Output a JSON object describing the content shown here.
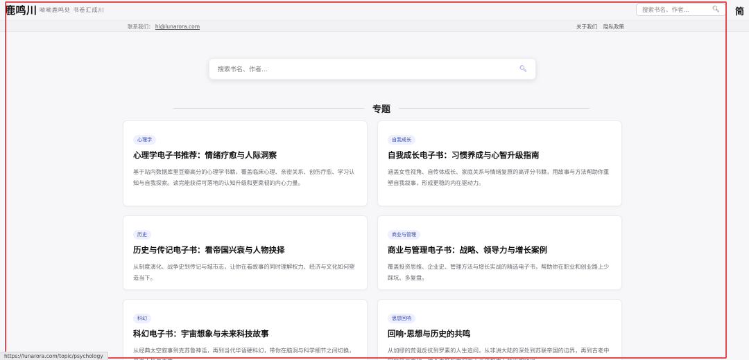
{
  "header": {
    "logo": "鹿鸣川",
    "slogan": "呦呦鹿鸣处 书卷汇成川",
    "search_placeholder": "搜索书名、作者...",
    "right_cut_text": "简"
  },
  "contact_bar": {
    "label": "联系我们：",
    "email": "hi@lunarora.com",
    "links": [
      "关于我们",
      "隐私政策"
    ]
  },
  "hero": {
    "search_placeholder": "搜索书名、作者..."
  },
  "section": {
    "title": "专题"
  },
  "cards": [
    {
      "tag": "心理学",
      "title": "心理学电子书推荐：情绪疗愈与人际洞察",
      "desc": "基于站内数据库里豆瓣高分的心理学书籍，覆盖临床心理、亲密关系、创伤疗愈、学习认知与自我探索。读完能获得可落地的认知升级和更柔韧的内心力量。"
    },
    {
      "tag": "自我成长",
      "title": "自我成长电子书：习惯养成与心智升级指南",
      "desc": "涵盖女性视角、自传体成长、家庭关系与情绪复原的高评分书籍，用故事与方法帮助你重塑自我叙事，形成更稳的内在驱动力。"
    },
    {
      "tag": "历史",
      "title": "历史与传记电子书：看帝国兴衰与人物抉择",
      "desc": "从制度演化、战争史到传记与城市志，让你在看故事的同时理解权力、经济与文化如何塑造当下。"
    },
    {
      "tag": "商业与管理",
      "title": "商业与管理电子书：战略、领导力与增长案例",
      "desc": "覆盖投资思维、企业史、管理方法与增长实战的精选电子书，帮助你在职业和创业路上少踩坑、多复盘。"
    },
    {
      "tag": "科幻",
      "title": "科幻电子书：宇宙想象与未来科技故事",
      "desc": "从经典太空叙事到克苏鲁神话，再到当代华语硬科幻，带你在脑洞与科学细节之间切换，思考人性与未来。"
    },
    {
      "tag": "思想回响",
      "title": "回响·思想与历史的共鸣",
      "desc": "从加缪的荒诞反抗到罗素的人生追问，从非洲大陆的深处到苏联帝国的边界，再到古老中国的风云变幻。这个专题旨在探索人类思想史上的光辉印记。"
    }
  ],
  "status_bar": {
    "url": "https://lunarora.com/topic/psychology"
  }
}
